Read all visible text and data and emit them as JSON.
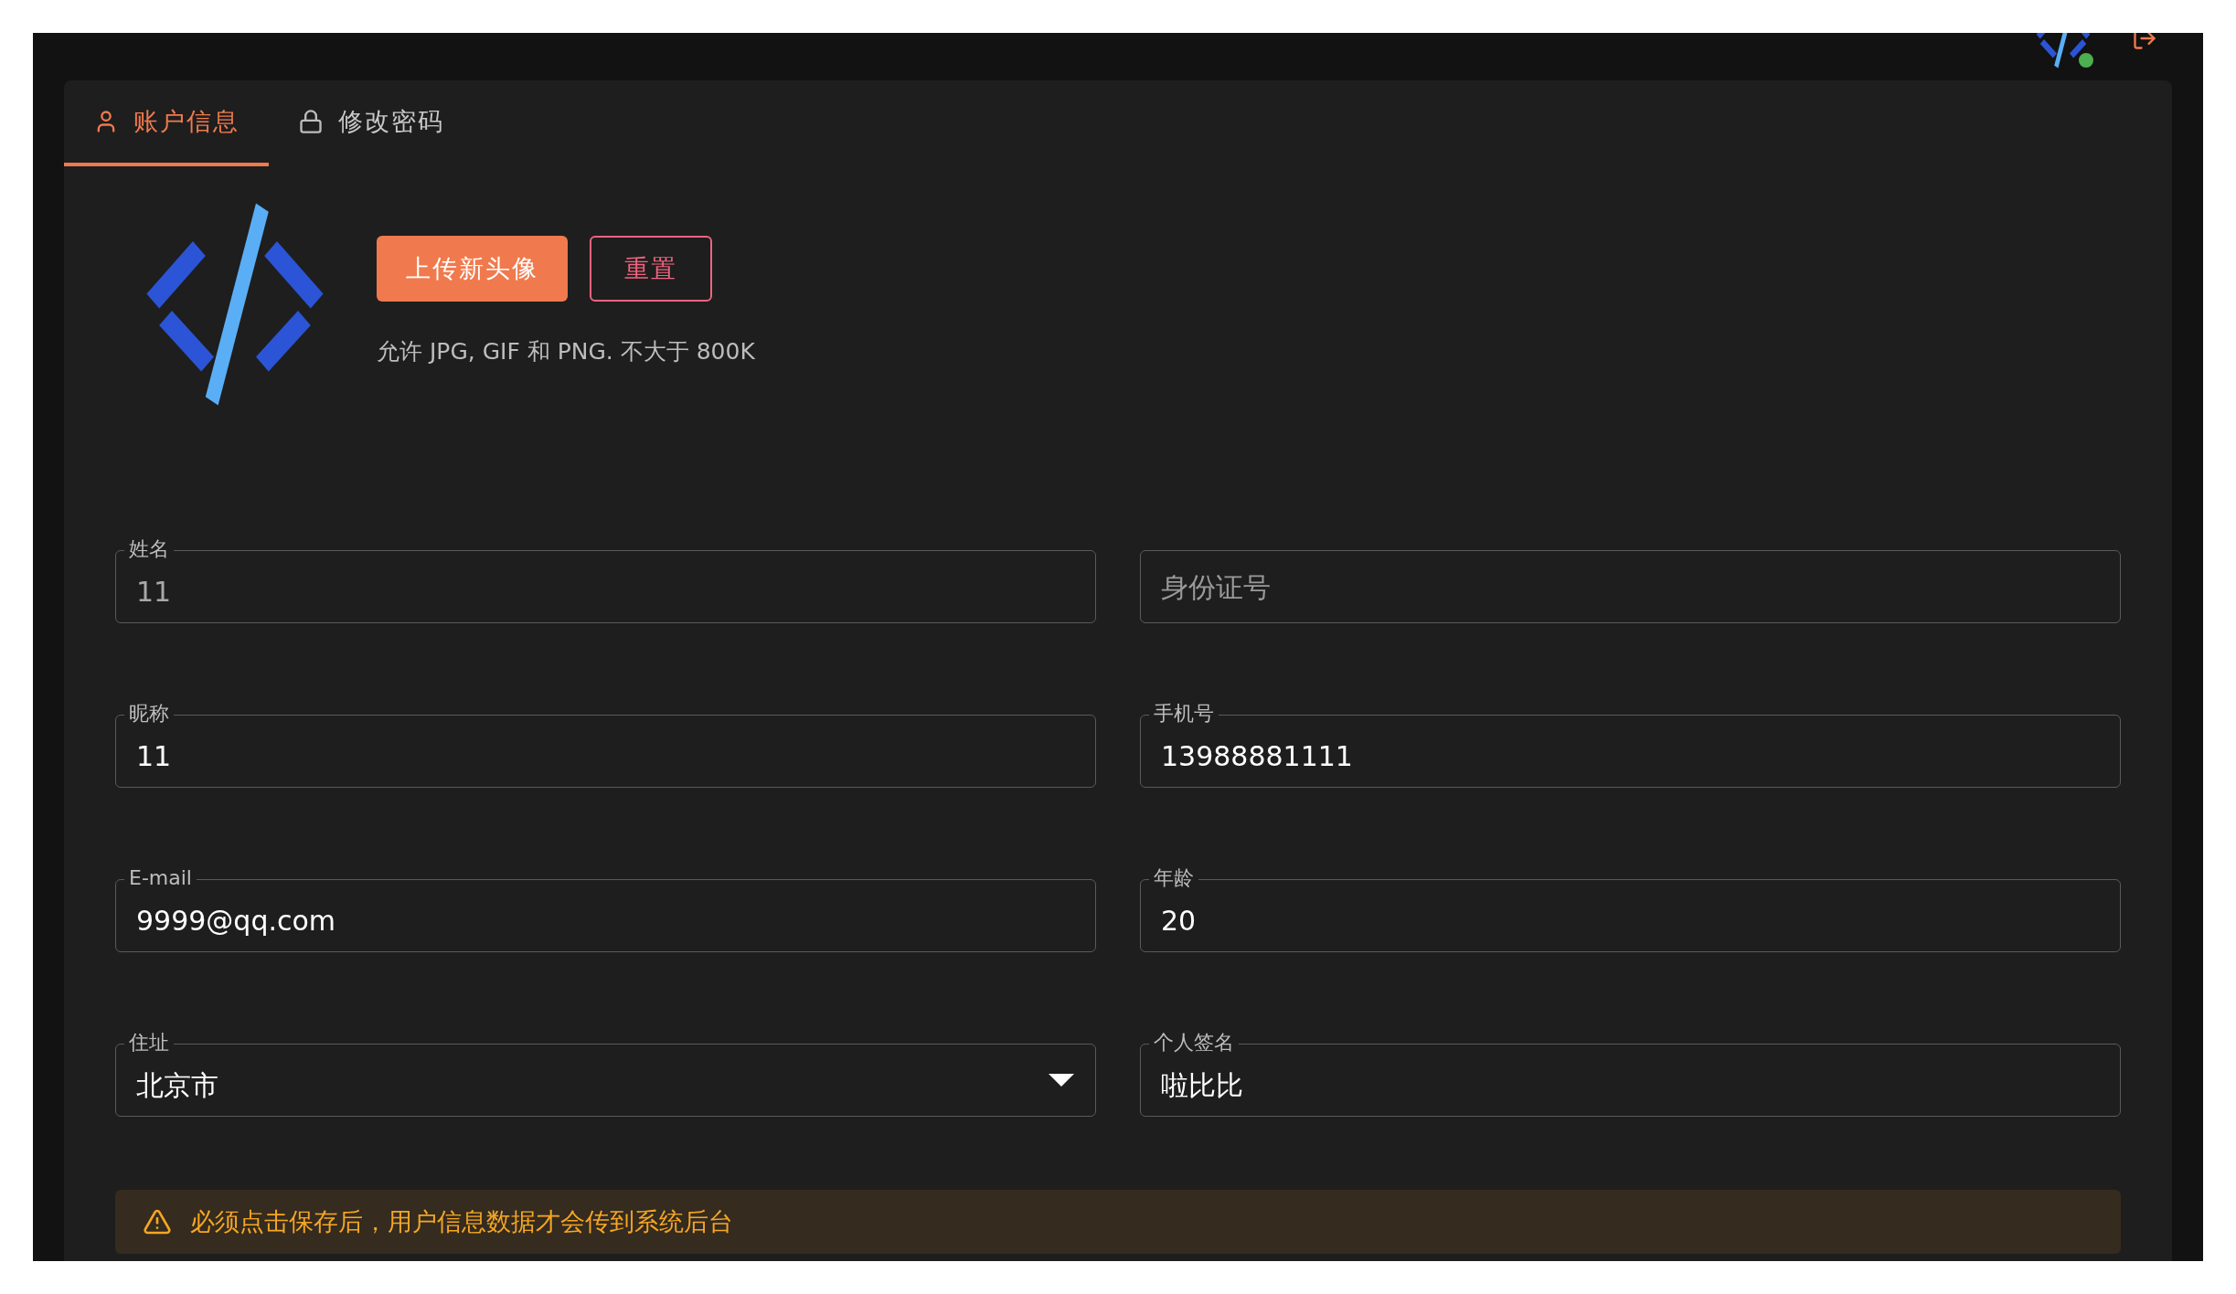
{
  "tabs": [
    {
      "label": "账户信息",
      "selected": true
    },
    {
      "label": "修改密码",
      "selected": false
    }
  ],
  "avatar": {
    "upload_button": "上传新头像",
    "reset_button": "重置",
    "hint": "允许 JPG, GIF 和 PNG. 不大于 800K"
  },
  "fields": [
    {
      "kind": "text",
      "label": "姓名",
      "value": "11"
    },
    {
      "kind": "text",
      "placeholder": "身份证号"
    },
    {
      "kind": "text",
      "label": "昵称",
      "value": "11"
    },
    {
      "kind": "text",
      "label": "手机号",
      "value": "13988881111"
    },
    {
      "kind": "text",
      "label": "E-mail",
      "value": "9999@qq.com"
    },
    {
      "kind": "text",
      "label": "年龄",
      "value": "20"
    },
    {
      "kind": "select",
      "label": "住址",
      "value": "北京市"
    },
    {
      "kind": "text",
      "label": "个人签名",
      "value": "啦比比"
    }
  ],
  "alert": {
    "text": "必须点击保存后，用户信息数据才会传到系统后台"
  }
}
